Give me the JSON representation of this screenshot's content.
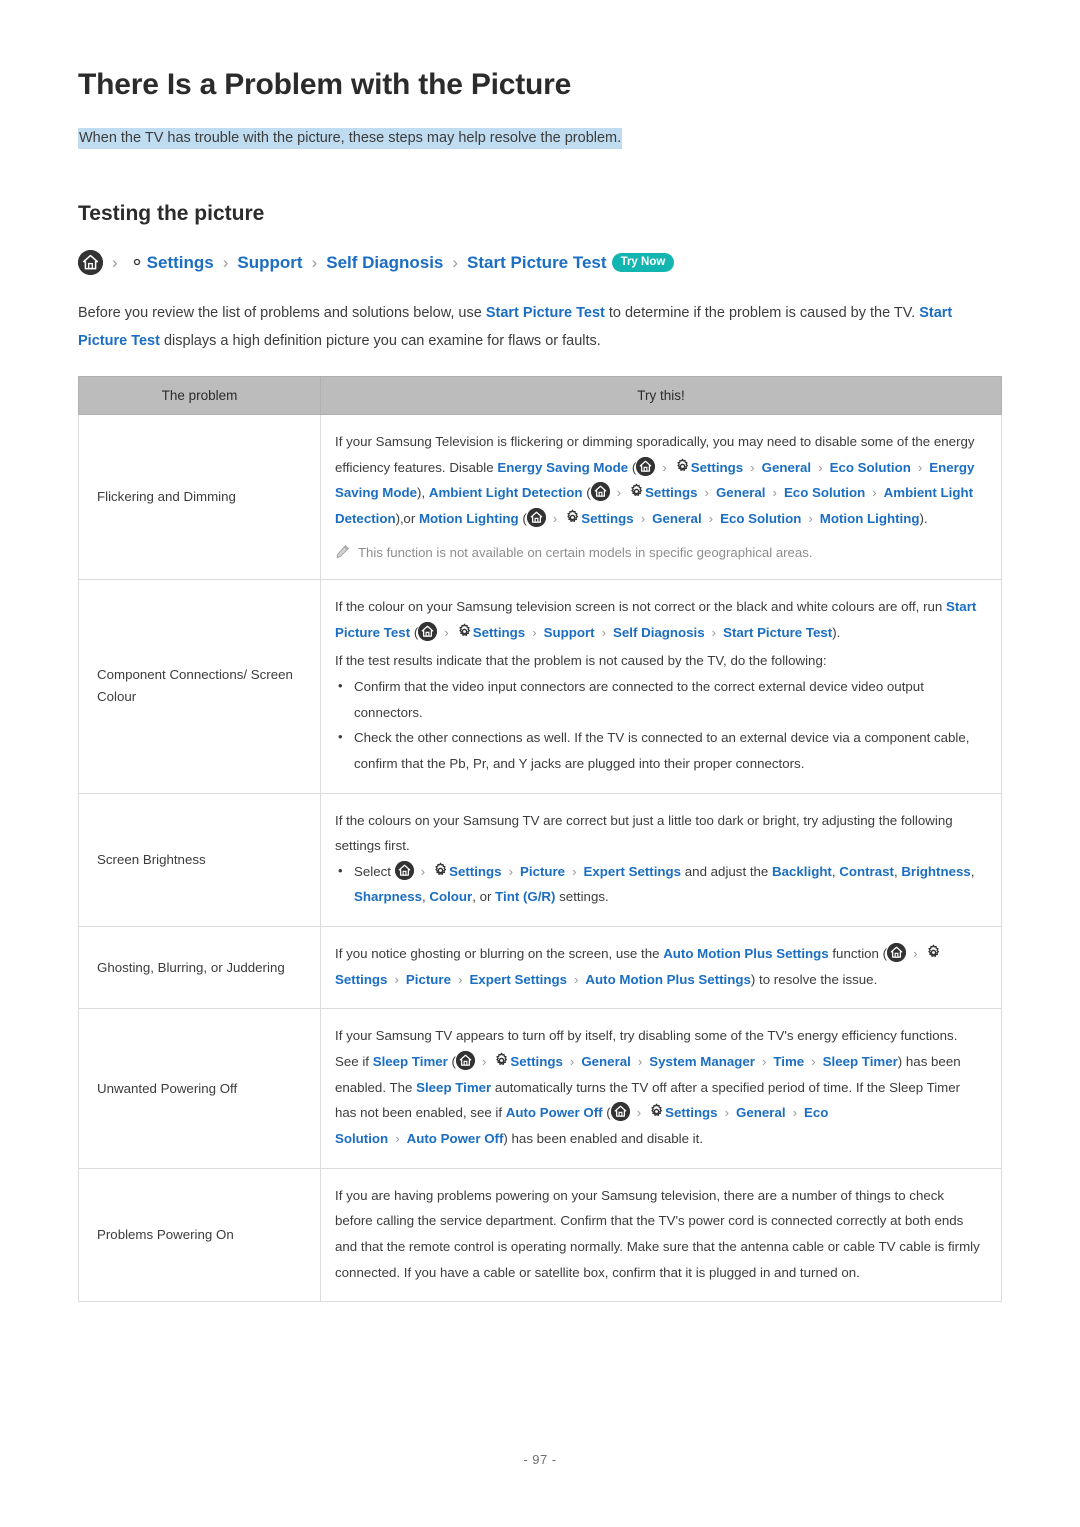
{
  "page": {
    "title": "There Is a Problem with the Picture",
    "subtitle": "When the TV has trouble with the picture, these steps may help resolve the problem.",
    "section_heading": "Testing the picture",
    "page_number": "- 97 -"
  },
  "breadcrumb": {
    "home_icon": "home-icon",
    "separator": "›",
    "items": [
      {
        "label": "Settings",
        "icon": "gear-icon"
      },
      {
        "label": "Support",
        "icon": null
      },
      {
        "label": "Self Diagnosis",
        "icon": null
      },
      {
        "label": "Start Picture Test",
        "icon": null
      }
    ],
    "badge": "Try Now",
    "badge_color": "#13b5b1"
  },
  "intro": {
    "part1": "Before you review the list of problems and solutions below, use ",
    "link1": "Start Picture Test",
    "part2": " to determine if the problem is caused by the TV. ",
    "link2": "Start Picture Test",
    "part3": " displays a high definition picture you can examine for flaws or faults."
  },
  "table": {
    "headers": {
      "col1": "The problem",
      "col2": "Try this!"
    },
    "rows": [
      {
        "problem": "Flickering and Dimming",
        "solution_text": "If your Samsung Television is flickering or dimming sporadically, you may need to disable some of the energy efficiency features. Disable Energy Saving Mode ( > Settings > General > Eco Solution > Energy Saving Mode), Ambient Light Detection ( > Settings > General > Eco Solution > Ambient Light Detection), or Motion Lighting ( > Settings > General > Eco Solution > Motion Lighting).",
        "note": "This function is not available on certain models in specific geographical areas."
      },
      {
        "problem": "Component Connections/ Screen Colour",
        "solution_p1": "If the colour on your Samsung television screen is not correct or the black and white colours are off, run Start Picture Test ( > Settings > Support > Self Diagnosis > Start Picture Test).",
        "solution_p2": "If the test results indicate that the problem is not caused by the TV, do the following:",
        "bullets": [
          "Confirm that the video input connectors are connected to the correct external device video output connectors.",
          "Check the other connections as well. If the TV is connected to an external device via a component cable, confirm that the Pb, Pr, and Y jacks are plugged into their proper connectors."
        ]
      },
      {
        "problem": "Screen Brightness",
        "solution_p1": "If the colours on your Samsung TV are correct but just a little too dark or bright, try adjusting the following settings first.",
        "bullet": "Select  > Settings > Picture > Expert Settings and adjust the Backlight, Contrast, Brightness, Sharpness, Colour, or Tint (G/R) settings."
      },
      {
        "problem": "Ghosting, Blurring, or Juddering",
        "solution_text": "If you notice ghosting or blurring on the screen, use the Auto Motion Plus Settings function ( > Settings > Picture > Expert Settings > Auto Motion Plus Settings) to resolve the issue."
      },
      {
        "problem": "Unwanted Powering Off",
        "solution_text": "If your Samsung TV appears to turn off by itself, try disabling some of the TV's energy efficiency functions. See if Sleep Timer ( > Settings > General > System Manager > Time > Sleep Timer) has been enabled. The Sleep Timer automatically turns the TV off after a specified period of time. If the Sleep Timer has not been enabled, see if Auto Power Off ( > Settings > General > Eco Solution > Auto Power Off) has been enabled and disable it."
      },
      {
        "problem": "Problems Powering On",
        "solution_text": "If you are having problems powering on your Samsung television, there are a number of things to check before calling the service department. Confirm that the TV's power cord is connected correctly at both ends and that the remote control is operating normally. Make sure that the antenna cable or cable TV cable is firmly connected. If you have a cable or satellite box, confirm that it is plugged in and turned on."
      }
    ]
  },
  "fragments": {
    "settings": "Settings",
    "general": "General",
    "eco_solution": "Eco Solution",
    "energy_saving_mode": "Energy Saving Mode",
    "ambient_light_detection": "Ambient Light Detection",
    "motion_lighting": "Motion Lighting",
    "support": "Support",
    "self_diagnosis": "Self Diagnosis",
    "start_picture_test": "Start Picture Test",
    "picture": "Picture",
    "expert_settings": "Expert Settings",
    "backlight": "Backlight",
    "contrast": "Contrast",
    "brightness": "Brightness",
    "sharpness": "Sharpness",
    "colour": "Colour",
    "tint": "Tint (G/R)",
    "auto_motion_plus": "Auto Motion Plus Settings",
    "sleep_timer": "Sleep Timer",
    "system_manager": "System Manager",
    "time": "Time",
    "auto_power_off": "Auto Power Off",
    "separator": "›",
    "r1_t1": "If your Samsung Television is flickering or dimming sporadically, you may need to disable some of the energy efficiency features. Disable ",
    "r1_t2": " (",
    "r1_t3": "), ",
    "r1_t4": ", or ",
    "r1_t5": ").",
    "r2_t1": "If the colour on your Samsung television screen is not correct or the black and white colours are off, run ",
    "r2_t2": " (",
    "r2_t3": ").",
    "r2_t4": "If the test results indicate that the problem is not caused by the TV, do the following:",
    "r3_t1": "If the colours on your Samsung TV are correct but just a little too dark or bright, try adjusting the following settings first.",
    "r3_t2": "Select ",
    "r3_t3": " and adjust the ",
    "r3_t4": ", or ",
    "r3_t5": " settings.",
    "r4_t1": "If you notice ghosting or blurring on the screen, use the ",
    "r4_t2": " function (",
    "r4_t3": ") to resolve the issue.",
    "r5_t1": "If your Samsung TV appears to turn off by itself, try disabling some of the TV's energy efficiency functions. See if ",
    "r5_t2": " (",
    "r5_t3": ") has been enabled. The ",
    "r5_t4": " automatically turns the TV off after a specified period of time. If the Sleep Timer has not been enabled, see if ",
    "r5_t5": " (",
    "r5_t6": ") has been enabled and disable it."
  }
}
